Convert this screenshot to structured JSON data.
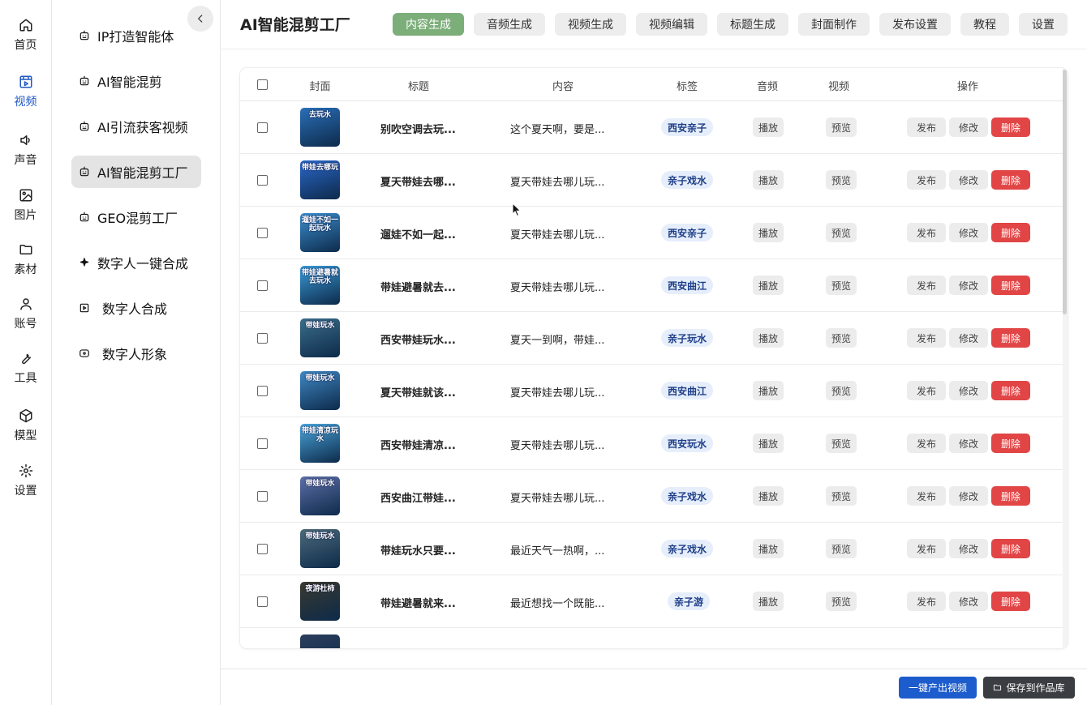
{
  "rail": [
    {
      "label": "首页",
      "icon": "home-icon"
    },
    {
      "label": "视频",
      "icon": "video-icon",
      "active": true
    },
    {
      "label": "声音",
      "icon": "speaker-icon"
    },
    {
      "label": "图片",
      "icon": "image-icon"
    },
    {
      "label": "素材",
      "icon": "folder-icon"
    },
    {
      "label": "账号",
      "icon": "user-icon"
    },
    {
      "label": "工具",
      "icon": "wrench-icon"
    },
    {
      "label": "模型",
      "icon": "cube-icon"
    },
    {
      "label": "设置",
      "icon": "gear-icon"
    }
  ],
  "sidebar": {
    "items": [
      {
        "label": "IP打造智能体"
      },
      {
        "label": "AI智能混剪"
      },
      {
        "label": "AI引流获客视频"
      },
      {
        "label": "AI智能混剪工厂",
        "active": true
      },
      {
        "label": "GEO混剪工厂"
      },
      {
        "label": "数字人一键合成"
      },
      {
        "label": "数字人合成"
      },
      {
        "label": "数字人形象"
      }
    ]
  },
  "header": {
    "title": "AI智能混剪工厂",
    "tabs": [
      {
        "label": "内容生成",
        "active": true
      },
      {
        "label": "音频生成"
      },
      {
        "label": "视频生成"
      },
      {
        "label": "视频编辑"
      },
      {
        "label": "标题生成"
      },
      {
        "label": "封面制作"
      },
      {
        "label": "发布设置"
      },
      {
        "label": "教程"
      },
      {
        "label": "设置"
      }
    ]
  },
  "table": {
    "columns": [
      "封面",
      "标题",
      "内容",
      "标签",
      "音频",
      "视频",
      "操作"
    ],
    "actions": {
      "play": "播放",
      "preview": "预览",
      "publish": "发布",
      "edit": "修改",
      "delete": "删除"
    },
    "rows": [
      {
        "cover_text": "去玩水",
        "cover_color": "#2a6fb8",
        "title": "别吹空调去玩...",
        "content": "这个夏天啊，要是...",
        "tag": "西安亲子"
      },
      {
        "cover_text": "带娃去哪玩",
        "cover_color": "#2a67c9",
        "title": "夏天带娃去哪...",
        "content": "夏天带娃去哪儿玩...",
        "tag": "亲子戏水"
      },
      {
        "cover_text": "遛娃不如一起玩水",
        "cover_color": "#3b8fd0",
        "title": "遛娃不如一起...",
        "content": "夏天带娃去哪儿玩...",
        "tag": "西安亲子"
      },
      {
        "cover_text": "带娃避暑就去玩水",
        "cover_color": "#3a9bd8",
        "title": "带娃避暑就去...",
        "content": "夏天带娃去哪儿玩...",
        "tag": "西安曲江"
      },
      {
        "cover_text": "带娃玩水",
        "cover_color": "#3a6e8a",
        "title": "西安带娃玩水...",
        "content": "夏天一到啊，带娃...",
        "tag": "亲子玩水"
      },
      {
        "cover_text": "带娃玩水",
        "cover_color": "#3f88c4",
        "title": "夏天带娃就该...",
        "content": "夏天带娃去哪儿玩...",
        "tag": "西安曲江"
      },
      {
        "cover_text": "带娃清凉玩水",
        "cover_color": "#4aa6dc",
        "title": "西安带娃清凉...",
        "content": "夏天带娃去哪儿玩...",
        "tag": "西安玩水"
      },
      {
        "cover_text": "带娃玩水",
        "cover_color": "#5d6fa8",
        "title": "西安曲江带娃...",
        "content": "夏天带娃去哪儿玩...",
        "tag": "亲子戏水"
      },
      {
        "cover_text": "带娃玩水",
        "cover_color": "#4c6a7a",
        "title": "带娃玩水只要...",
        "content": "最近天气一热啊，...",
        "tag": "亲子戏水"
      },
      {
        "cover_text": "夜游杜柿",
        "cover_color": "#3a3a2e",
        "title": "带娃避暑就来...",
        "content": "最近想找一个既能...",
        "tag": "亲子游"
      },
      {
        "cover_text": "",
        "cover_color": "#2c3e5c",
        "title": "",
        "content": "",
        "tag": ""
      }
    ]
  },
  "footer": {
    "generate_label": "一键产出视频",
    "save_label": "保存到作品库"
  },
  "colors": {
    "accent": "#1d5ccc",
    "active_tab": "#7cae7a",
    "delete": "#e14545",
    "tag_bg": "#e6eefb",
    "tag_text": "#1e3f88"
  }
}
